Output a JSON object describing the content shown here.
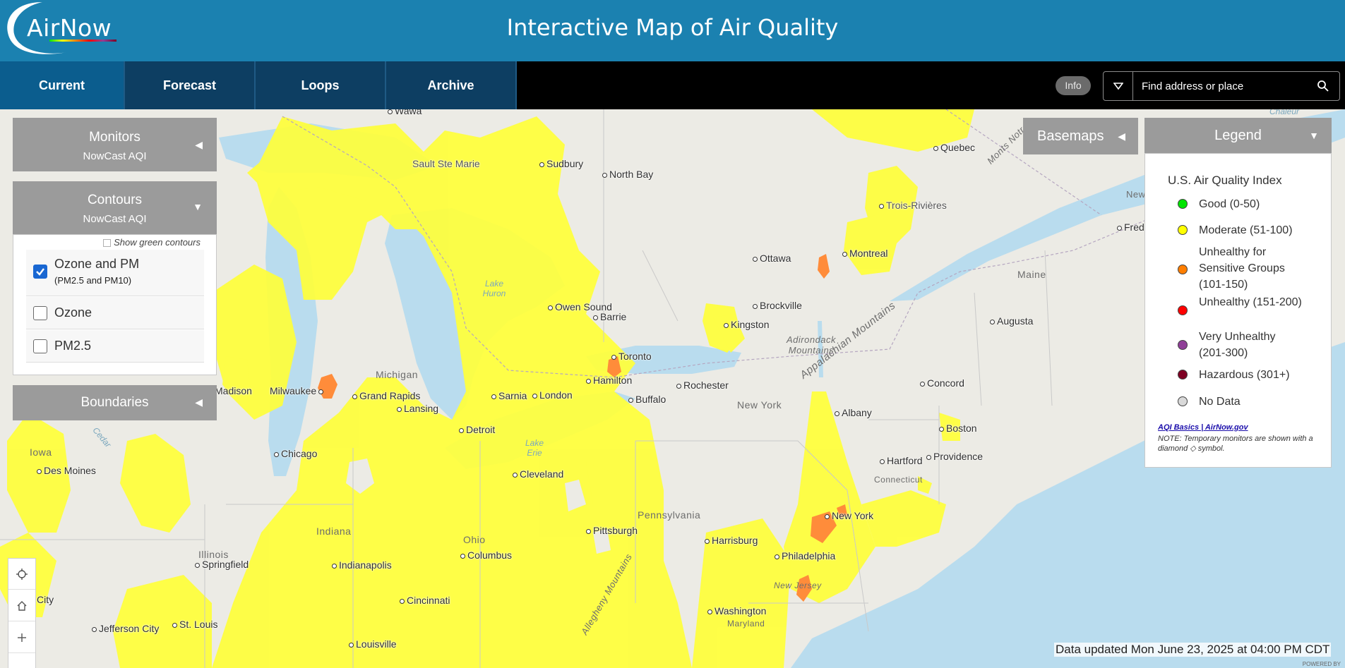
{
  "header": {
    "logo_text": "AirNow",
    "title": "Interactive Map of Air Quality"
  },
  "nav": {
    "tabs": [
      {
        "label": "Current",
        "active": true
      },
      {
        "label": "Forecast",
        "active": false
      },
      {
        "label": "Loops",
        "active": false
      },
      {
        "label": "Archive",
        "active": false
      }
    ],
    "info_label": "Info",
    "search_placeholder": "Find address or place"
  },
  "panels": {
    "monitors": {
      "title": "Monitors",
      "subtitle": "NowCast AQI",
      "caret": "◀"
    },
    "contours": {
      "title": "Contours",
      "subtitle": "NowCast AQI",
      "caret": "▼",
      "show_green": "Show green contours",
      "options": [
        {
          "label": "Ozone and PM",
          "sub": "(PM2.5 and PM10)",
          "checked": true
        },
        {
          "label": "Ozone",
          "sub": "",
          "checked": false
        },
        {
          "label": "PM2.5",
          "sub": "",
          "checked": false
        }
      ]
    },
    "boundaries": {
      "title": "Boundaries",
      "caret": "◀"
    },
    "basemaps": {
      "title": "Basemaps",
      "caret": "◀"
    },
    "legend": {
      "title": "Legend",
      "caret": "▼",
      "heading": "U.S. Air Quality Index",
      "items": [
        {
          "label": "Good (0-50)",
          "color": "#00e400"
        },
        {
          "label": "Moderate (51-100)",
          "color": "#ffff00"
        },
        {
          "label": "Unhealthy for Sensitive Groups (101-150)",
          "color": "#ff7e00"
        },
        {
          "label": "Unhealthy (151-200)",
          "color": "#ff0000"
        },
        {
          "label": "Very Unhealthy (201-300)",
          "color": "#8f3f97"
        },
        {
          "label": "Hazardous (301+)",
          "color": "#7e0023"
        },
        {
          "label": "No Data",
          "color": "#d9d9d9"
        }
      ],
      "link": "AQI Basics | AirNow.gov",
      "note": "NOTE: Temporary monitors are shown with a diamond ◇ symbol."
    }
  },
  "map": {
    "cities": [
      "Wawa",
      "Sudbury",
      "North Bay",
      "Sault Ste Marie",
      "Quebec",
      "Trois-Rivières",
      "Montreal",
      "Ottawa",
      "Brockville",
      "Kingston",
      "Owen Sound",
      "Barrie",
      "Toronto",
      "Hamilton",
      "Rochester",
      "Buffalo",
      "London",
      "Sarnia",
      "Grand Rapids",
      "Lansing",
      "Milwaukee",
      "Madison",
      "Detroit",
      "Chicago",
      "Des Moines",
      "Cleveland",
      "Albany",
      "Concord",
      "Augusta",
      "Boston",
      "Providence",
      "Hartford",
      "New York",
      "Harrisburg",
      "Philadelphia",
      "Pittsburgh",
      "Columbus",
      "Indianapolis",
      "Springfield",
      "Cincinnati",
      "St. Louis",
      "Jefferson City",
      "Louisville",
      "Washington",
      "Fred",
      "City"
    ],
    "regions": [
      "Michigan",
      "Ohio",
      "Indiana",
      "Illinois",
      "Iowa",
      "Pennsylvania",
      "New York",
      "Maine",
      "New Brunswi",
      "Adirondack Mountains",
      "Appalachian Mountains",
      "Allegheny Mountains",
      "Monts Notre",
      "Connecticut",
      "New Jersey",
      "Maryland"
    ],
    "waters": [
      "Lake Huron",
      "Lake Erie",
      "Cedar",
      "Chaleur"
    ]
  },
  "footer": {
    "updated": "Data updated Mon June 23, 2025 at 04:00 PM CDT",
    "powered": "POWERED BY"
  },
  "icons": [
    "locate-icon",
    "home-icon",
    "zoom-in-icon",
    "zoom-out-icon",
    "search-icon",
    "chevron-down-icon"
  ]
}
